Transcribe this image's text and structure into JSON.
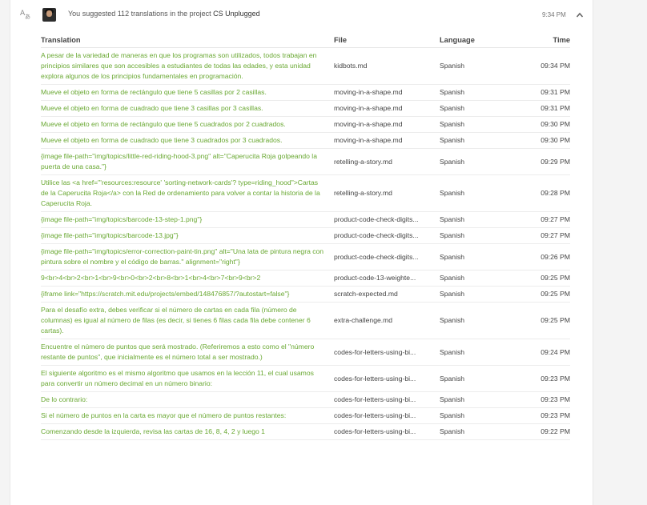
{
  "activity": {
    "summary_prefix": "You suggested 112 translations in the project",
    "project": "CS Unplugged",
    "timestamp": "9:34 PM"
  },
  "table": {
    "headers": {
      "translation": "Translation",
      "file": "File",
      "language": "Language",
      "time": "Time"
    },
    "rows": [
      {
        "translation": "A pesar de la variedad de maneras en que los programas son utilizados, todos trabajan en principios similares que son accesibles a estudiantes de todas las edades, y esta unidad explora algunos de los principios fundamentales en programación.",
        "file": "kidbots.md",
        "language": "Spanish",
        "time": "09:34 PM"
      },
      {
        "translation": "Mueve el objeto en forma de rectángulo que tiene 5 casillas por 2 casillas.",
        "file": "moving-in-a-shape.md",
        "language": "Spanish",
        "time": "09:31 PM"
      },
      {
        "translation": "Mueve el objeto en forma de cuadrado que tiene 3 casillas por 3 casillas.",
        "file": "moving-in-a-shape.md",
        "language": "Spanish",
        "time": "09:31 PM"
      },
      {
        "translation": "Mueve el objeto en forma de rectángulo que tiene 5 cuadrados por 2 cuadrados.",
        "file": "moving-in-a-shape.md",
        "language": "Spanish",
        "time": "09:30 PM"
      },
      {
        "translation": "Mueve el objeto en forma de cuadrado que tiene 3 cuadrados por 3 cuadrados.",
        "file": "moving-in-a-shape.md",
        "language": "Spanish",
        "time": "09:30 PM"
      },
      {
        "translation": "{image file-path=\"img/topics/little-red-riding-hood-3.png\" alt=\"Caperucita Roja golpeando la puerta de una casa.\"}",
        "file": "retelling-a-story.md",
        "language": "Spanish",
        "time": "09:29 PM"
      },
      {
        "translation": "Utilice las <a href=\"'resources:resource' 'sorting-network-cards'? type=riding_hood\">Cartas de la Caperucita Roja</a> con la Red de ordenamiento para volver a contar la historia de la Caperucita Roja.",
        "file": "retelling-a-story.md",
        "language": "Spanish",
        "time": "09:28 PM"
      },
      {
        "translation": "{image file-path=\"img/topics/barcode-13-step-1.png\"}",
        "file": "product-code-check-digits...",
        "language": "Spanish",
        "time": "09:27 PM"
      },
      {
        "translation": "{image file-path=\"img/topics/barcode-13.jpg\"}",
        "file": "product-code-check-digits...",
        "language": "Spanish",
        "time": "09:27 PM"
      },
      {
        "translation": "{image file-path=\"img/topics/error-correction-paint-tin.png\" alt=\"Una lata de pintura negra con pintura sobre el nombre y el código de barras.\" alignment=\"right\"}",
        "file": "product-code-check-digits...",
        "language": "Spanish",
        "time": "09:26 PM"
      },
      {
        "translation": "9<br>4<br>2<br>1<br>9<br>0<br>2<br>8<br>1<br>4<br>7<br>9<br>2",
        "file": "product-code-13-weighte...",
        "language": "Spanish",
        "time": "09:25 PM"
      },
      {
        "translation": "{iframe link=\"https://scratch.mit.edu/projects/embed/148476857/?autostart=false\"}",
        "file": "scratch-expected.md",
        "language": "Spanish",
        "time": "09:25 PM"
      },
      {
        "translation": "Para el desafío extra, debes verificar si el número de cartas en cada fila (número de columnas) es igual al número de filas (es decir, si tienes 6 filas cada fila debe contener 6 cartas).",
        "file": "extra-challenge.md",
        "language": "Spanish",
        "time": "09:25 PM"
      },
      {
        "translation": "Encuentre el número de puntos que será mostrado. (Referiremos a esto como el \"número restante de puntos\", que inicialmente es el número total a ser mostrado.)",
        "file": "codes-for-letters-using-bi...",
        "language": "Spanish",
        "time": "09:24 PM"
      },
      {
        "translation": "El siguiente algoritmo es el mismo algoritmo que usamos en la lección 11, el cual usamos para convertir un número decimal en un número binario:",
        "file": "codes-for-letters-using-bi...",
        "language": "Spanish",
        "time": "09:23 PM"
      },
      {
        "translation": "De lo contrario:",
        "file": "codes-for-letters-using-bi...",
        "language": "Spanish",
        "time": "09:23 PM"
      },
      {
        "translation": "Si el número de puntos en la carta es mayor que el número de puntos restantes:",
        "file": "codes-for-letters-using-bi...",
        "language": "Spanish",
        "time": "09:23 PM"
      },
      {
        "translation": "Comenzando desde la izquierda, revisa las cartas de 16, 8, 4, 2 y luego 1",
        "file": "codes-for-letters-using-bi...",
        "language": "Spanish",
        "time": "09:22 PM"
      }
    ]
  }
}
